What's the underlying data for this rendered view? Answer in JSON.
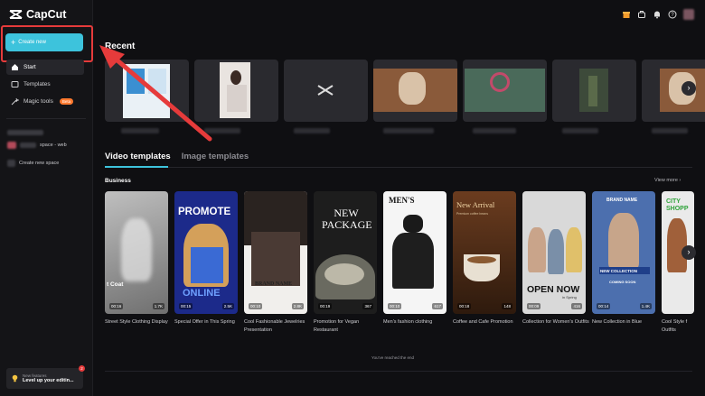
{
  "app": {
    "name": "CapCut"
  },
  "sidebar": {
    "create_label": "Create new",
    "items": [
      {
        "label": "Start",
        "icon": "home-icon"
      },
      {
        "label": "Templates",
        "icon": "templates-icon"
      },
      {
        "label": "Magic tools",
        "icon": "magic-icon",
        "badge": "Beta"
      }
    ],
    "space_label": "space - web",
    "create_space_label": "Create new space",
    "news": {
      "title": "New features",
      "subtitle": "Level up your editin...",
      "count": "2"
    }
  },
  "main": {
    "recent_title": "Recent",
    "tabs": [
      {
        "label": "Video templates"
      },
      {
        "label": "Image templates"
      }
    ],
    "section_title": "Business",
    "view_more": "View more",
    "end_text": "You've reached the end",
    "cards": [
      {
        "title": "Street Style Clothing Display",
        "duration": "00:16",
        "likes": "1.7K",
        "overlay": "t Coat"
      },
      {
        "title": "Special Offer in This Spring",
        "duration": "00:15",
        "likes": "2.5K",
        "overlay": "PROMOTE",
        "overlay2": "ONLINE"
      },
      {
        "title": "Cool Fashionable Jewelries Presentation",
        "duration": "00:10",
        "likes": "2.8K",
        "overlay": "BRAND NAME"
      },
      {
        "title": "Promotion for Vegan Restaurant",
        "duration": "00:19",
        "likes": "367",
        "overlay": "NEW PACKAGE"
      },
      {
        "title": "Men's fashion clothing",
        "duration": "00:10",
        "likes": "617",
        "overlay": "MEN'S"
      },
      {
        "title": "Coffee and Cafe Promotion",
        "duration": "00:18",
        "likes": "148",
        "overlay": "New Arrival",
        "overlay2": "Premium coffee beans"
      },
      {
        "title": "Collection for Women's Outfits",
        "duration": "00:09",
        "likes": "416",
        "overlay": "OPEN NOW",
        "overlay2": "in Spring"
      },
      {
        "title": "New Collection in Blue",
        "duration": "00:14",
        "likes": "1.4K",
        "overlay": "BRAND NAME",
        "overlay2": "NEW COLLECTION",
        "overlay3": "COMING SOON"
      },
      {
        "title": "Cool Style f Outfits",
        "duration": "",
        "likes": "",
        "overlay": "CITY SHOPP"
      }
    ]
  },
  "colors": {
    "accent": "#3dc3dc",
    "annotation": "#e63b3b",
    "beta": "#ff7a2f"
  }
}
